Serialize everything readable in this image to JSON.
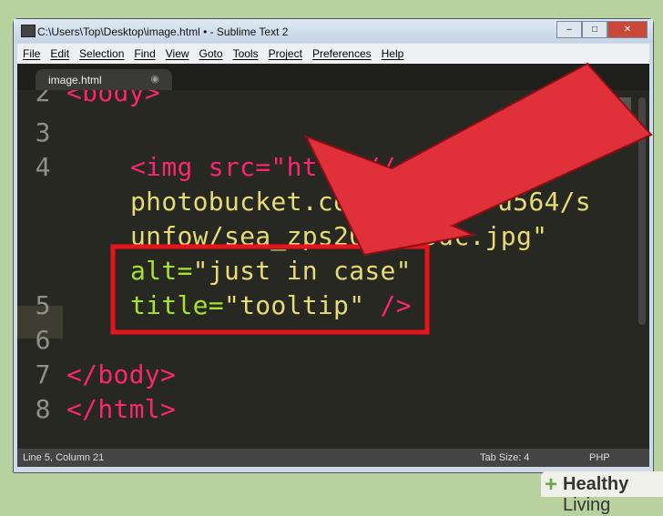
{
  "window": {
    "title": "C:\\Users\\Top\\Desktop\\image.html • - Sublime Text 2",
    "buttons": [
      "–",
      "□",
      "✕"
    ]
  },
  "menu": [
    "File",
    "Edit",
    "Selection",
    "Find",
    "View",
    "Goto",
    "Tools",
    "Project",
    "Preferences",
    "Help"
  ],
  "tab": {
    "label": "image.html",
    "close": "◉"
  },
  "code": {
    "line_numbers": [
      "2",
      "3",
      "4",
      "5",
      "6",
      "7",
      "8"
    ],
    "l2": "<body>",
    "l4a": "<img src=\"http://",
    "l4b": "photobucket.com/",
    "l4b2": "u564/s",
    "l4c": "unfow/sea_zps20",
    "l4c2": "5dc.jpg\"",
    "l4d_attr": "alt=",
    "l4d_val": "\"just in case\"",
    "l5_attr": "title=",
    "l5_val": "\"tooltip\"",
    "l5_end": " />",
    "l7": "</body>",
    "l8": "</html>"
  },
  "status": {
    "position": "Line 5, Column 21",
    "tab_size": "Tab Size: 4",
    "syntax": "PHP"
  },
  "watermark": {
    "brand": "Healthy",
    "brand2": "Living"
  },
  "colors": {
    "highlight_box": "#e8141c",
    "arrow": "#e0303a"
  }
}
